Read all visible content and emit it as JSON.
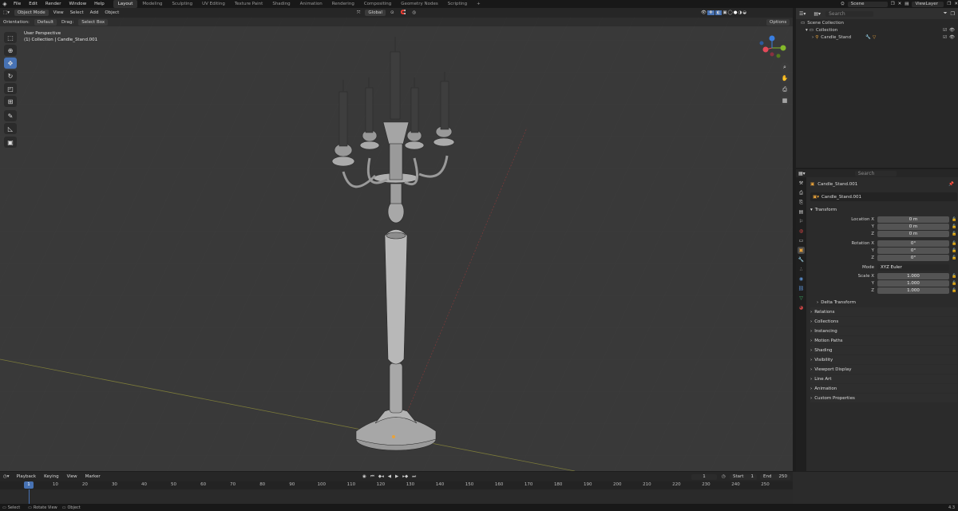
{
  "topbar": {
    "menus": [
      "File",
      "Edit",
      "Render",
      "Window",
      "Help"
    ],
    "workspaces": [
      "Layout",
      "Modeling",
      "Sculpting",
      "UV Editing",
      "Texture Paint",
      "Shading",
      "Animation",
      "Rendering",
      "Compositing",
      "Geometry Nodes",
      "Scripting"
    ],
    "active_workspace": "Layout",
    "scene": "Scene",
    "view_layer": "ViewLayer"
  },
  "viewport_header": {
    "mode": "Object Mode",
    "menus": [
      "View",
      "Select",
      "Add",
      "Object"
    ],
    "transform_orientation": "Global",
    "orientation_label": "Orientation:",
    "orientation_value": "Default",
    "drag_label": "Drag:",
    "drag_value": "Select Box",
    "options_label": "Options"
  },
  "viewport_info": {
    "line1": "User Perspective",
    "line2": "(1) Collection | Candle_Stand.001"
  },
  "gizmo": {
    "x_label": "X",
    "y_label": "Y",
    "z_label": "Z",
    "x_color": "#e44a5a",
    "y_color": "#84b92a",
    "z_color": "#3a7ee0"
  },
  "outliner": {
    "search_placeholder": "Search",
    "scene_collection": "Scene Collection",
    "collection": "Collection",
    "object": "Candle_Stand"
  },
  "properties": {
    "search_placeholder": "Search",
    "object_name": "Candle_Stand.001",
    "data_name": "Candle_Stand.001",
    "transform_title": "Transform",
    "location_label": "Location X",
    "rotation_label": "Rotation X",
    "scale_label": "Scale X",
    "axis_y": "Y",
    "axis_z": "Z",
    "location": [
      "0 m",
      "0 m",
      "0 m"
    ],
    "rotation": [
      "0°",
      "0°",
      "0°"
    ],
    "mode_label": "Mode",
    "mode_value": "XYZ Euler",
    "scale": [
      "1.000",
      "1.000",
      "1.000"
    ],
    "delta_transform": "Delta Transform",
    "sections": [
      "Relations",
      "Collections",
      "Instancing",
      "Motion Paths",
      "Shading",
      "Visibility",
      "Viewport Display",
      "Line Art",
      "Animation",
      "Custom Properties"
    ]
  },
  "timeline": {
    "menus": [
      "Playback",
      "Keying",
      "View",
      "Marker"
    ],
    "current_frame": "1",
    "start_label": "Start",
    "start_value": "1",
    "end_label": "End",
    "end_value": "250",
    "playhead_label": "1",
    "ticks": [
      "10",
      "20",
      "30",
      "40",
      "50",
      "60",
      "70",
      "80",
      "90",
      "100",
      "110",
      "120",
      "130",
      "140",
      "150",
      "160",
      "170",
      "180",
      "190",
      "200",
      "210",
      "220",
      "230",
      "240",
      "250"
    ]
  },
  "statusbar": {
    "items": [
      "Select",
      "Rotate View",
      "Object"
    ],
    "version": "4.3"
  },
  "colors": {
    "accent": "#4772b3",
    "viewport_bg": "#393939",
    "selection_orange": "#e8a23a"
  }
}
